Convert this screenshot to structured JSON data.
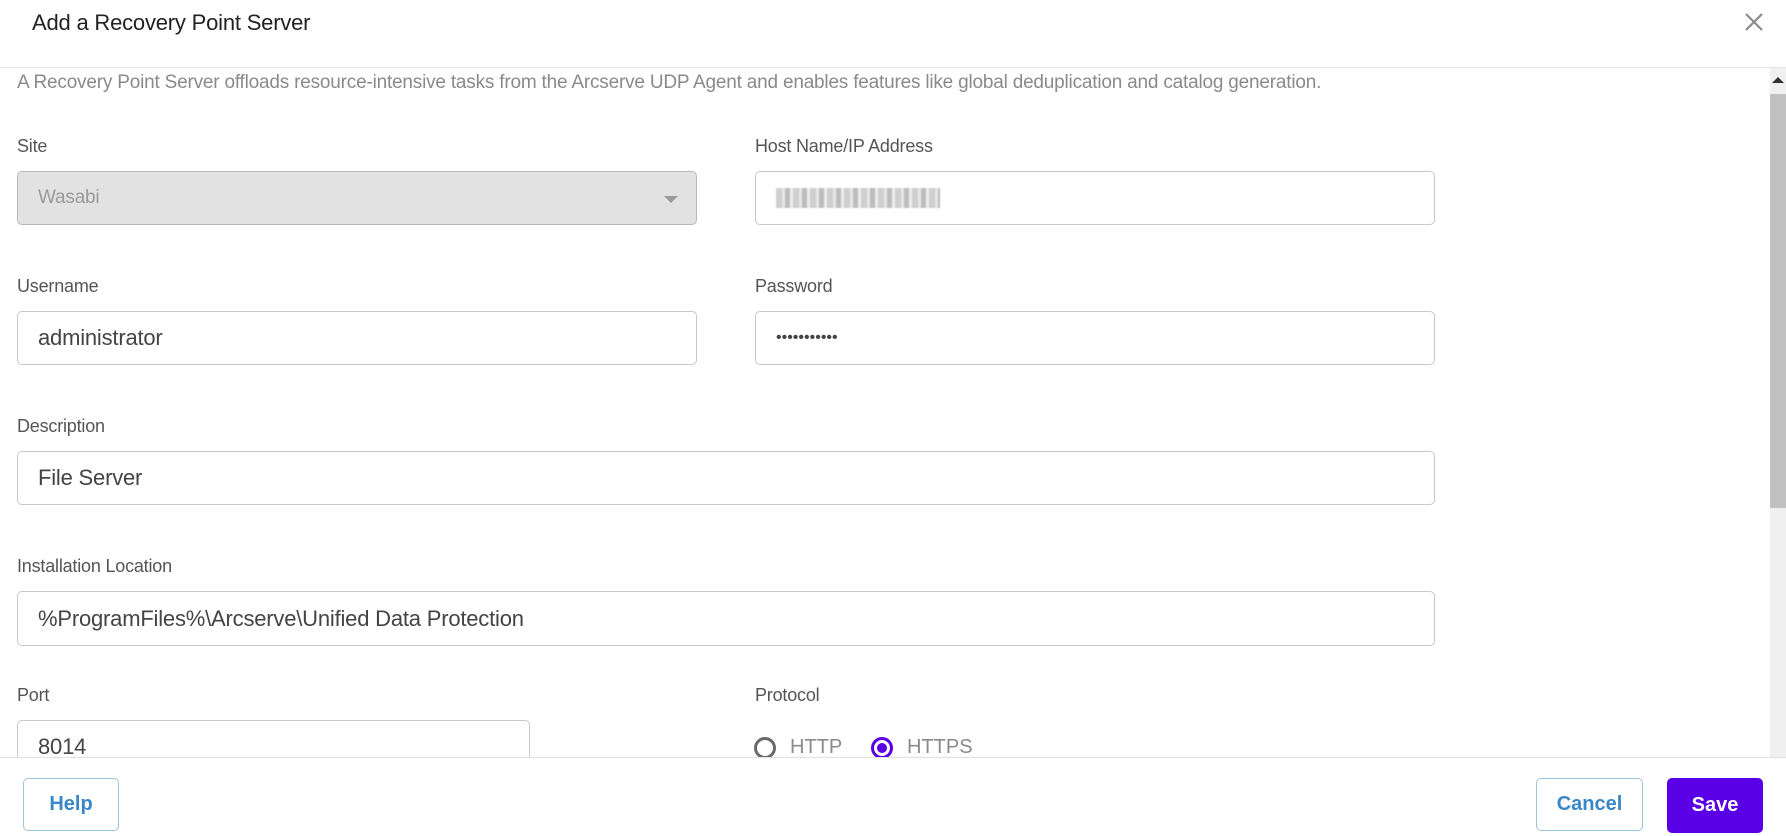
{
  "dialog": {
    "title": "Add a Recovery Point Server",
    "close_icon": "close-icon",
    "intro": "A Recovery Point Server offloads resource-intensive tasks from the Arcserve UDP Agent and enables features like global deduplication and catalog generation."
  },
  "form": {
    "site": {
      "label": "Site",
      "value": "Wasabi",
      "disabled": true,
      "icon": "chevron-down-icon"
    },
    "host": {
      "label": "Host Name/IP Address",
      "value": "(obscured)"
    },
    "username": {
      "label": "Username",
      "value": "administrator"
    },
    "password": {
      "label": "Password",
      "value": "•••••••••••"
    },
    "description": {
      "label": "Description",
      "value": "File Server"
    },
    "install_location": {
      "label": "Installation Location",
      "value": "%ProgramFiles%\\Arcserve\\Unified Data Protection"
    },
    "port": {
      "label": "Port",
      "value": "8014"
    },
    "protocol": {
      "label": "Protocol",
      "options": [
        {
          "label": "HTTP",
          "selected": false
        },
        {
          "label": "HTTPS",
          "selected": true
        }
      ]
    }
  },
  "footer": {
    "help_label": "Help",
    "cancel_label": "Cancel",
    "save_label": "Save"
  },
  "colors": {
    "accent": "#5a00e6",
    "link": "#3a87c8"
  }
}
